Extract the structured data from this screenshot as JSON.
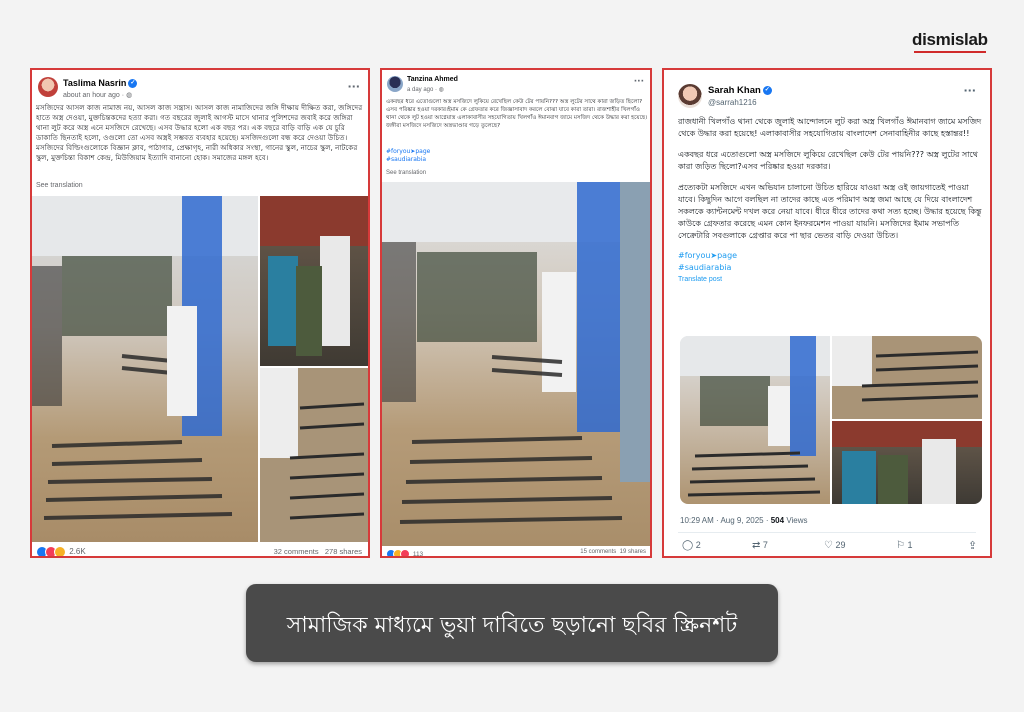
{
  "brand": {
    "logo": "dismislab"
  },
  "posts": [
    {
      "author": "Taslima Nasrin",
      "time": "about an hour ago · ",
      "text": "মসজিদের আসল কাজ নামাজ নয়, আসল কাজ সন্ত্রাস। আসল কাজ নামাজিদের জঙ্গি দীক্ষায় দীক্ষিত করা, জঙ্গিদের হাতে অস্ত্র দেওয়া, মুক্তচিন্তকদের হত্যা করা। গত বছরের জুলাই আগস্ট মাসে থানার পুলিশদের জবাই করে জঙ্গিরা থানা লুট করে অস্ত্র এনে মসজিদে রেখেছে। এসব উদ্ধার হলো এক বছর পর। এক বছরে বাড়ি বাড়ি এক যে চুরি ডাকাতি ছিনতাই হলো, ওগুলো তো এসব অস্ত্রই সম্ভবত ব্যবহার হয়েছে। মসজিদগুলো বন্ধ করে দেওয়া উচিত। মসজিদের বিল্ডিংগুলোকে বিজ্ঞান ক্লাব, পাঠাগার, প্রেক্ষাগৃহ, নারী অধিকার সংস্থা, গানের স্কুল, নাচের স্কুল, নাটকের স্কুল, মুক্তচিন্তা বিকাশ কেন্দ্র, মিউজিয়াম ইত্যাদি বানানো হোক। সমাজের মঙ্গল হবে।",
      "see_translation": "See translation",
      "reactions": "2.6K",
      "comments": "32 comments",
      "shares": "278 shares",
      "more": "···"
    },
    {
      "author": "Tanzina Ahmed",
      "time": "a day ago · ",
      "text": "একবছর ধরে এতোগুলো অস্ত্র মসজিদে লুকিয়ে রেখেছিল কেউ টের পায়নি??? অস্ত্র লুটের সাথে কারা জড়িত ছিলো?এসব পরিষ্কার হওয়া দরকার।ইমাম কে গ্রেফতার করে জিজ্ঞাসাবাদ করলে বোঝা যাবে কারা তারা। রাজশাহীর খিলগাঁও থানা থেকে লুট হওয়া আগ্নেয়াস্ত্র এলাকাবাসীর সহযোগিতায় খিলগাঁও ঈমানবাগ জামে মসজিদ থেকে উদ্ধার করা হয়েছে। জঙ্গীরা মসজিদে মসজিদে অস্ত্রভাণ্ডার গড়ে তুলেছে?",
      "hashtags": [
        "#foryou➤page",
        "#saudiarabia"
      ],
      "see_translation": "See translation",
      "reactions": "113",
      "comments": "15 comments",
      "shares": "19 shares",
      "more": "···"
    },
    {
      "author": "Sarah Khan",
      "handle": "@sarrah1216",
      "paragraphs": [
        "রাজধানী খিলগাঁও থানা থেকে জুলাই আন্দোলনে লুট করা অস্ত্র খিলগাঁও ঈমানবাগ জামে মসজিদ থেকে উদ্ধার করা হয়েছে! এলাকাবাসীর সহযোগিতায় বাংলাদেশ সেনাবাহিনীর কাছে হস্তান্তর!!",
        "একবছর ধরে এতোগুলো অস্ত্র মসজিদে লুকিয়ে রেখেছিল কেউ টের পায়নি??? অস্ত্র লুটের সাথে কারা জড়িত ছিলো?এসব পরিষ্কার হওয়া দরকার।",
        "প্রত্যেকটা মসজিদে এখন অভিযান চালানো উচিত হারিয়ে যাওয়া অস্ত্র ওই জায়গাতেই পাওয়া যাবে। কিছুদিন আগে বলছিল না তাদের কাছে এত পরিমাণ অস্ত্র জমা আছে যে দিয়ে বাংলাদেশ সকলকে ক্যান্টনমেন্ট দখল করে নেয়া যাবে। ধীরে ধীরে তাদের কথা সত্য হচ্ছে। উদ্ধার হয়েছে কিন্তু কাউকে গ্রেফতার করেছে এমন কোন ইনফরমেশন পাওয়া যায়নি। মসজিদের ইমাম সভাপতি সেক্রেটারি সবগুলাকে গ্রেপ্তার করে পা ছার ভেতর বাড়ি দেওয়া উচিত।"
      ],
      "hashtags": [
        "#foryou➤page",
        "#saudiarabia"
      ],
      "translate": "Translate post",
      "timestamp": "10:29 AM · Aug 9, 2025 · ",
      "views_count": "504",
      "views_label": " Views",
      "replies": "2",
      "retweets": "7",
      "likes": "29",
      "bookmarks": "1",
      "more": "···"
    }
  ],
  "caption": "সামাজিক মাধ্যমে ভুয়া দাবিতে ছড়ানো ছবির স্ক্রিনশট",
  "colors": {
    "frame_red": "#d63a3a",
    "link_blue": "#1877f2",
    "caption_bg": "#4a4a4a"
  }
}
